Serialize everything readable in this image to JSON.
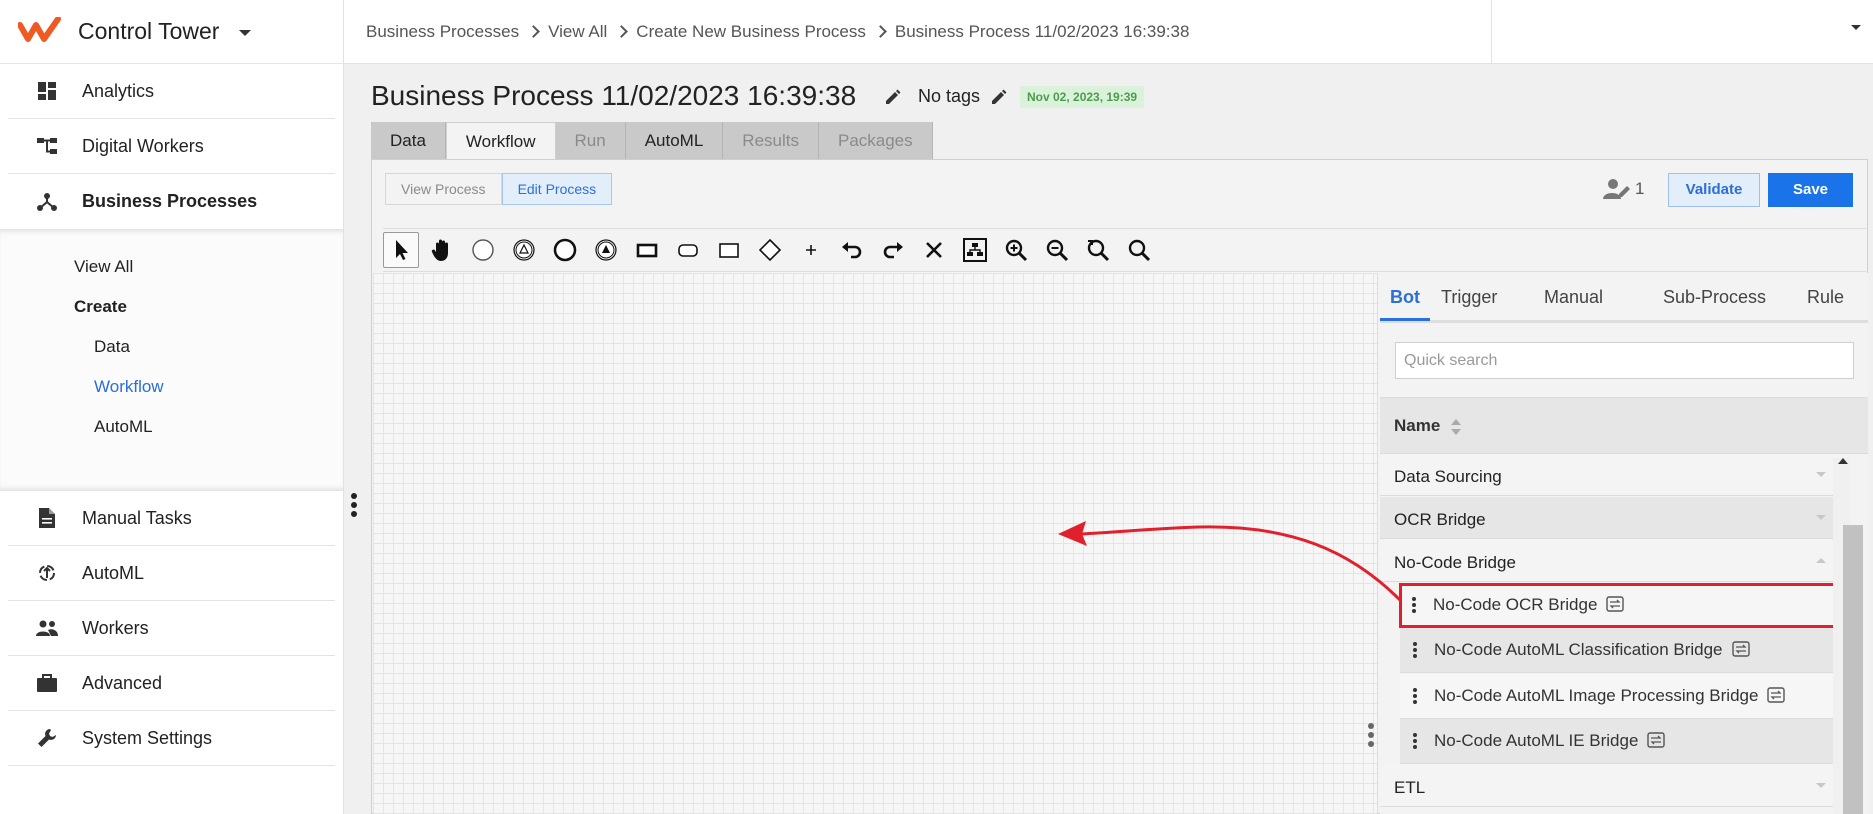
{
  "app": {
    "name": "Control Tower"
  },
  "sidebar": {
    "items": [
      {
        "label": "Analytics",
        "icon": "dashboard-icon"
      },
      {
        "label": "Digital Workers",
        "icon": "workers-tree-icon"
      },
      {
        "label": "Business Processes",
        "icon": "process-nodes-icon"
      }
    ],
    "sub": {
      "view_all": "View All",
      "create": "Create",
      "data": "Data",
      "workflow": "Workflow",
      "automl": "AutoML"
    },
    "lower_items": [
      {
        "label": "Manual Tasks",
        "icon": "document-icon"
      },
      {
        "label": "AutoML",
        "icon": "automl-icon"
      },
      {
        "label": "Workers",
        "icon": "people-icon"
      },
      {
        "label": "Advanced",
        "icon": "briefcase-icon"
      },
      {
        "label": "System Settings",
        "icon": "wrench-icon"
      }
    ]
  },
  "breadcrumb": [
    "Business Processes",
    "View All",
    "Create New Business Process",
    "Business Process 11/02/2023 16:39:38"
  ],
  "header": {
    "title": "Business Process 11/02/2023 16:39:38",
    "tags": "No tags",
    "date_badge": "Nov 02, 2023, 19:39"
  },
  "tabs": [
    {
      "label": "Data",
      "state": "normal"
    },
    {
      "label": "Workflow",
      "state": "active"
    },
    {
      "label": "Run",
      "state": "disabled"
    },
    {
      "label": "AutoML",
      "state": "normal"
    },
    {
      "label": "Results",
      "state": "disabled"
    },
    {
      "label": "Packages",
      "state": "disabled"
    }
  ],
  "editor": {
    "view_process": "View Process",
    "edit_process": "Edit Process",
    "user_count": "1",
    "validate": "Validate",
    "save": "Save"
  },
  "palette": {
    "tabs": [
      "Bot",
      "Trigger",
      "Manual",
      "Sub-Process",
      "Rule"
    ],
    "search_placeholder": "Quick search",
    "column": "Name",
    "groups": {
      "data_sourcing": "Data Sourcing",
      "ocr_bridge": "OCR Bridge",
      "no_code_bridge": "No-Code Bridge",
      "etl": "ETL"
    },
    "items": [
      "No-Code OCR Bridge",
      "No-Code AutoML Classification Bridge",
      "No-Code AutoML Image Processing Bridge",
      "No-Code AutoML IE Bridge"
    ]
  },
  "colors": {
    "accent": "#1a73e8",
    "highlight": "#e0202c",
    "badge_bg": "#d9f2d9",
    "brand": "#ef5a24"
  }
}
